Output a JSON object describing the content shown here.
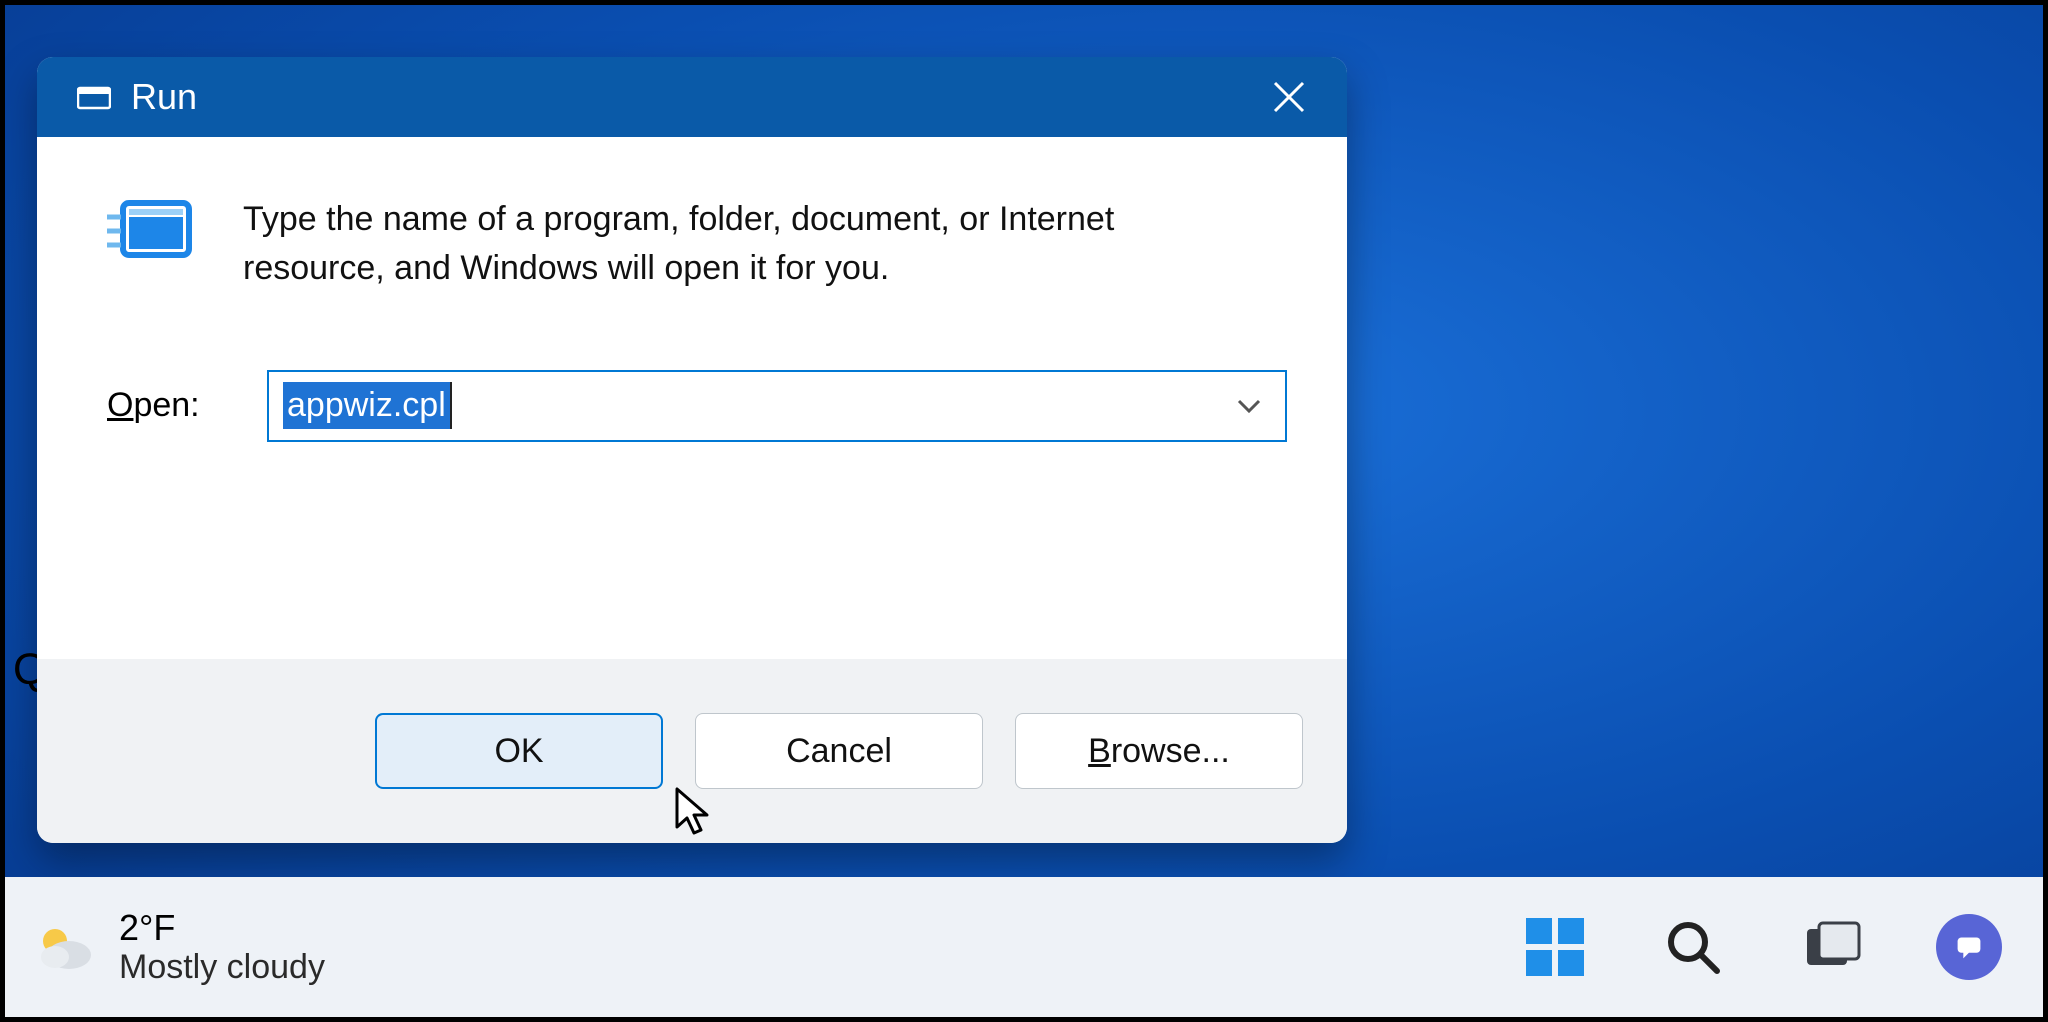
{
  "dialog": {
    "title": "Run",
    "description": "Type the name of a program, folder, document, or Internet resource, and Windows will open it for you.",
    "open_label_prefix": "O",
    "open_label_rest": "pen:",
    "input_value": "appwiz.cpl",
    "buttons": {
      "ok": "OK",
      "cancel": "Cancel",
      "browse_prefix": "B",
      "browse_rest": "rowse..."
    }
  },
  "taskbar": {
    "temperature": "2°F",
    "condition": "Mostly cloudy"
  }
}
